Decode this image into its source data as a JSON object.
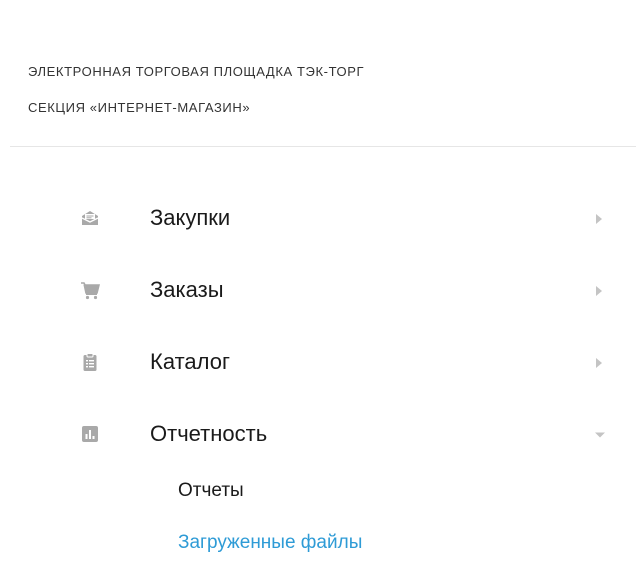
{
  "header": {
    "line1": "ЭЛЕКТРОННАЯ ТОРГОВАЯ ПЛОЩАДКА ТЭК-ТОРГ",
    "line2": "СЕКЦИЯ «ИНТЕРНЕТ-МАГАЗИН»"
  },
  "menu": {
    "items": [
      {
        "label": "Закупки",
        "icon": "envelope-icon",
        "state": "collapsed"
      },
      {
        "label": "Заказы",
        "icon": "cart-icon",
        "state": "collapsed"
      },
      {
        "label": "Каталог",
        "icon": "clipboard-icon",
        "state": "collapsed"
      },
      {
        "label": "Отчетность",
        "icon": "bar-chart-icon",
        "state": "expanded"
      }
    ],
    "subitems": [
      {
        "label": "Отчеты",
        "active": false
      },
      {
        "label": "Загруженные файлы",
        "active": true
      }
    ]
  },
  "colors": {
    "icon": "#a9a9a9",
    "arrow": "#c4c4c4",
    "active_link": "#2e9bd6",
    "text": "#1a1a1a"
  }
}
